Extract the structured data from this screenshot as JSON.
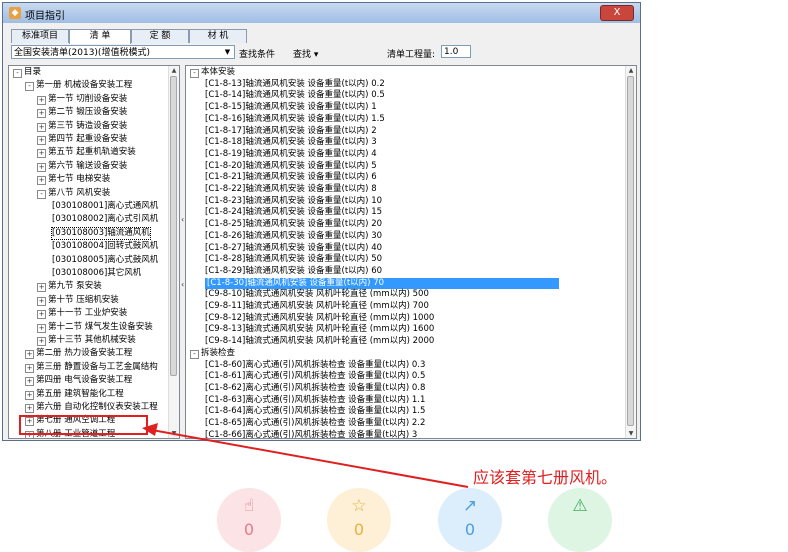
{
  "window": {
    "title": "项目指引",
    "close_label": "X"
  },
  "tabs": [
    {
      "label": "标准项目",
      "active": false
    },
    {
      "label": "清 单",
      "active": true
    },
    {
      "label": "定 额",
      "active": false
    },
    {
      "label": "材 机",
      "active": false
    }
  ],
  "toolbar": {
    "library_value": "全国安装清单(2013)(增值税模式)",
    "search_condition_label": "查找条件",
    "find_label": "查找 ▾",
    "quantity_label": "清单工程量:",
    "quantity_value": "1.0"
  },
  "left_tree": [
    {
      "level": 0,
      "toggle": "-",
      "label": "目录"
    },
    {
      "level": 1,
      "toggle": "-",
      "label": "第一册  机械设备安装工程"
    },
    {
      "level": 2,
      "toggle": "+",
      "label": "第一节  切削设备安装"
    },
    {
      "level": 2,
      "toggle": "+",
      "label": "第二节  锻压设备安装"
    },
    {
      "level": 2,
      "toggle": "+",
      "label": "第三节  铸造设备安装"
    },
    {
      "level": 2,
      "toggle": "+",
      "label": "第四节  起重设备安装"
    },
    {
      "level": 2,
      "toggle": "+",
      "label": "第五节  起重机轨道安装"
    },
    {
      "level": 2,
      "toggle": "+",
      "label": "第六节  输送设备安装"
    },
    {
      "level": 2,
      "toggle": "+",
      "label": "第七节  电梯安装"
    },
    {
      "level": 2,
      "toggle": "-",
      "label": "第八节  风机安装"
    },
    {
      "level": 3,
      "toggle": "",
      "label": "[030108001]离心式通风机"
    },
    {
      "level": 3,
      "toggle": "",
      "label": "[030108002]离心式引风机"
    },
    {
      "level": 3,
      "toggle": "",
      "label": "[030108003]轴流通风机",
      "boxed": true
    },
    {
      "level": 3,
      "toggle": "",
      "label": "[030108004]回转式鼓风机"
    },
    {
      "level": 3,
      "toggle": "",
      "label": "[030108005]离心式鼓风机"
    },
    {
      "level": 3,
      "toggle": "",
      "label": "[030108006]其它风机"
    },
    {
      "level": 2,
      "toggle": "+",
      "label": "第九节  泵安装"
    },
    {
      "level": 2,
      "toggle": "+",
      "label": "第十节  压缩机安装"
    },
    {
      "level": 2,
      "toggle": "+",
      "label": "第十一节  工业炉安装"
    },
    {
      "level": 2,
      "toggle": "+",
      "label": "第十二节  煤气发生设备安装"
    },
    {
      "level": 2,
      "toggle": "+",
      "label": "第十三节  其他机械安装"
    },
    {
      "level": 1,
      "toggle": "+",
      "label": "第二册  热力设备安装工程"
    },
    {
      "level": 1,
      "toggle": "+",
      "label": "第三册  静置设备与工艺金属结构"
    },
    {
      "level": 1,
      "toggle": "+",
      "label": "第四册  电气设备安装工程"
    },
    {
      "level": 1,
      "toggle": "+",
      "label": "第五册  建筑智能化工程"
    },
    {
      "level": 1,
      "toggle": "+",
      "label": "第六册  自动化控制仪表安装工程"
    },
    {
      "level": 1,
      "toggle": "+",
      "label": "第七册  通风空调工程"
    },
    {
      "level": 1,
      "toggle": "+",
      "label": "第八册  工业管道工程"
    }
  ],
  "right_tree": [
    {
      "level": 0,
      "toggle": "-",
      "label": "本体安装"
    },
    {
      "level": 1,
      "label": "[C1-8-13]轴流通风机安装 设备重量(t以内) 0.2"
    },
    {
      "level": 1,
      "label": "[C1-8-14]轴流通风机安装 设备重量(t以内) 0.5"
    },
    {
      "level": 1,
      "label": "[C1-8-15]轴流通风机安装 设备重量(t以内) 1"
    },
    {
      "level": 1,
      "label": "[C1-8-16]轴流通风机安装 设备重量(t以内) 1.5"
    },
    {
      "level": 1,
      "label": "[C1-8-17]轴流通风机安装 设备重量(t以内) 2"
    },
    {
      "level": 1,
      "label": "[C1-8-18]轴流通风机安装 设备重量(t以内) 3"
    },
    {
      "level": 1,
      "label": "[C1-8-19]轴流通风机安装 设备重量(t以内) 4"
    },
    {
      "level": 1,
      "label": "[C1-8-20]轴流通风机安装 设备重量(t以内) 5"
    },
    {
      "level": 1,
      "label": "[C1-8-21]轴流通风机安装 设备重量(t以内) 6"
    },
    {
      "level": 1,
      "label": "[C1-8-22]轴流通风机安装 设备重量(t以内) 8"
    },
    {
      "level": 1,
      "label": "[C1-8-23]轴流通风机安装 设备重量(t以内) 10"
    },
    {
      "level": 1,
      "label": "[C1-8-24]轴流通风机安装 设备重量(t以内) 15"
    },
    {
      "level": 1,
      "label": "[C1-8-25]轴流通风机安装 设备重量(t以内) 20"
    },
    {
      "level": 1,
      "label": "[C1-8-26]轴流通风机安装 设备重量(t以内) 30"
    },
    {
      "level": 1,
      "label": "[C1-8-27]轴流通风机安装 设备重量(t以内) 40"
    },
    {
      "level": 1,
      "label": "[C1-8-28]轴流通风机安装 设备重量(t以内) 50"
    },
    {
      "level": 1,
      "label": "[C1-8-29]轴流通风机安装 设备重量(t以内) 60"
    },
    {
      "level": 1,
      "label": "[C1-8-30]轴流通风机安装 设备重量(t以内) 70",
      "selected": true
    },
    {
      "level": 1,
      "label": "[C9-8-10]轴流式通风机安装 风机叶轮直径 (mm以内)  500"
    },
    {
      "level": 1,
      "label": "[C9-8-11]轴流式通风机安装 风机叶轮直径 (mm以内)  700"
    },
    {
      "level": 1,
      "label": "[C9-8-12]轴流式通风机安装 风机叶轮直径 (mm以内)  1000"
    },
    {
      "level": 1,
      "label": "[C9-8-13]轴流式通风机安装 风机叶轮直径 (mm以内)  1600"
    },
    {
      "level": 1,
      "label": "[C9-8-14]轴流式通风机安装 风机叶轮直径 (mm以内)  2000"
    },
    {
      "level": 0,
      "toggle": "-",
      "label": "拆装检查"
    },
    {
      "level": 1,
      "label": "[C1-8-60]离心式通(引)风机拆装检查 设备重量(t以内) 0.3"
    },
    {
      "level": 1,
      "label": "[C1-8-61]离心式通(引)风机拆装检查 设备重量(t以内) 0.5"
    },
    {
      "level": 1,
      "label": "[C1-8-62]离心式通(引)风机拆装检查 设备重量(t以内) 0.8"
    },
    {
      "level": 1,
      "label": "[C1-8-63]离心式通(引)风机拆装检查 设备重量(t以内) 1.1"
    },
    {
      "level": 1,
      "label": "[C1-8-64]离心式通(引)风机拆装检查 设备重量(t以内) 1.5"
    },
    {
      "level": 1,
      "label": "[C1-8-65]离心式通(引)风机拆装检查 设备重量(t以内) 2.2"
    },
    {
      "level": 1,
      "label": "[C1-8-66]离心式通(引)风机拆装检查 设备重量(t以内) 3"
    }
  ],
  "annotation": {
    "note": "应该套第七册风机。",
    "color": "#e02020"
  },
  "reactions": [
    {
      "icon": "thumbs-up-icon",
      "glyph": "👍",
      "count": "0",
      "bg": "#fbe3e6",
      "color": "#e87a8a"
    },
    {
      "icon": "star-icon",
      "glyph": "☆",
      "count": "0",
      "bg": "#fdf0d6",
      "color": "#e8b040"
    },
    {
      "icon": "share-icon",
      "glyph": "↗",
      "count": "0",
      "bg": "#dceefc",
      "color": "#4a9ee0"
    },
    {
      "icon": "warning-icon",
      "glyph": "⚠",
      "count": "",
      "bg": "#def5e4",
      "color": "#3fae5c"
    }
  ]
}
